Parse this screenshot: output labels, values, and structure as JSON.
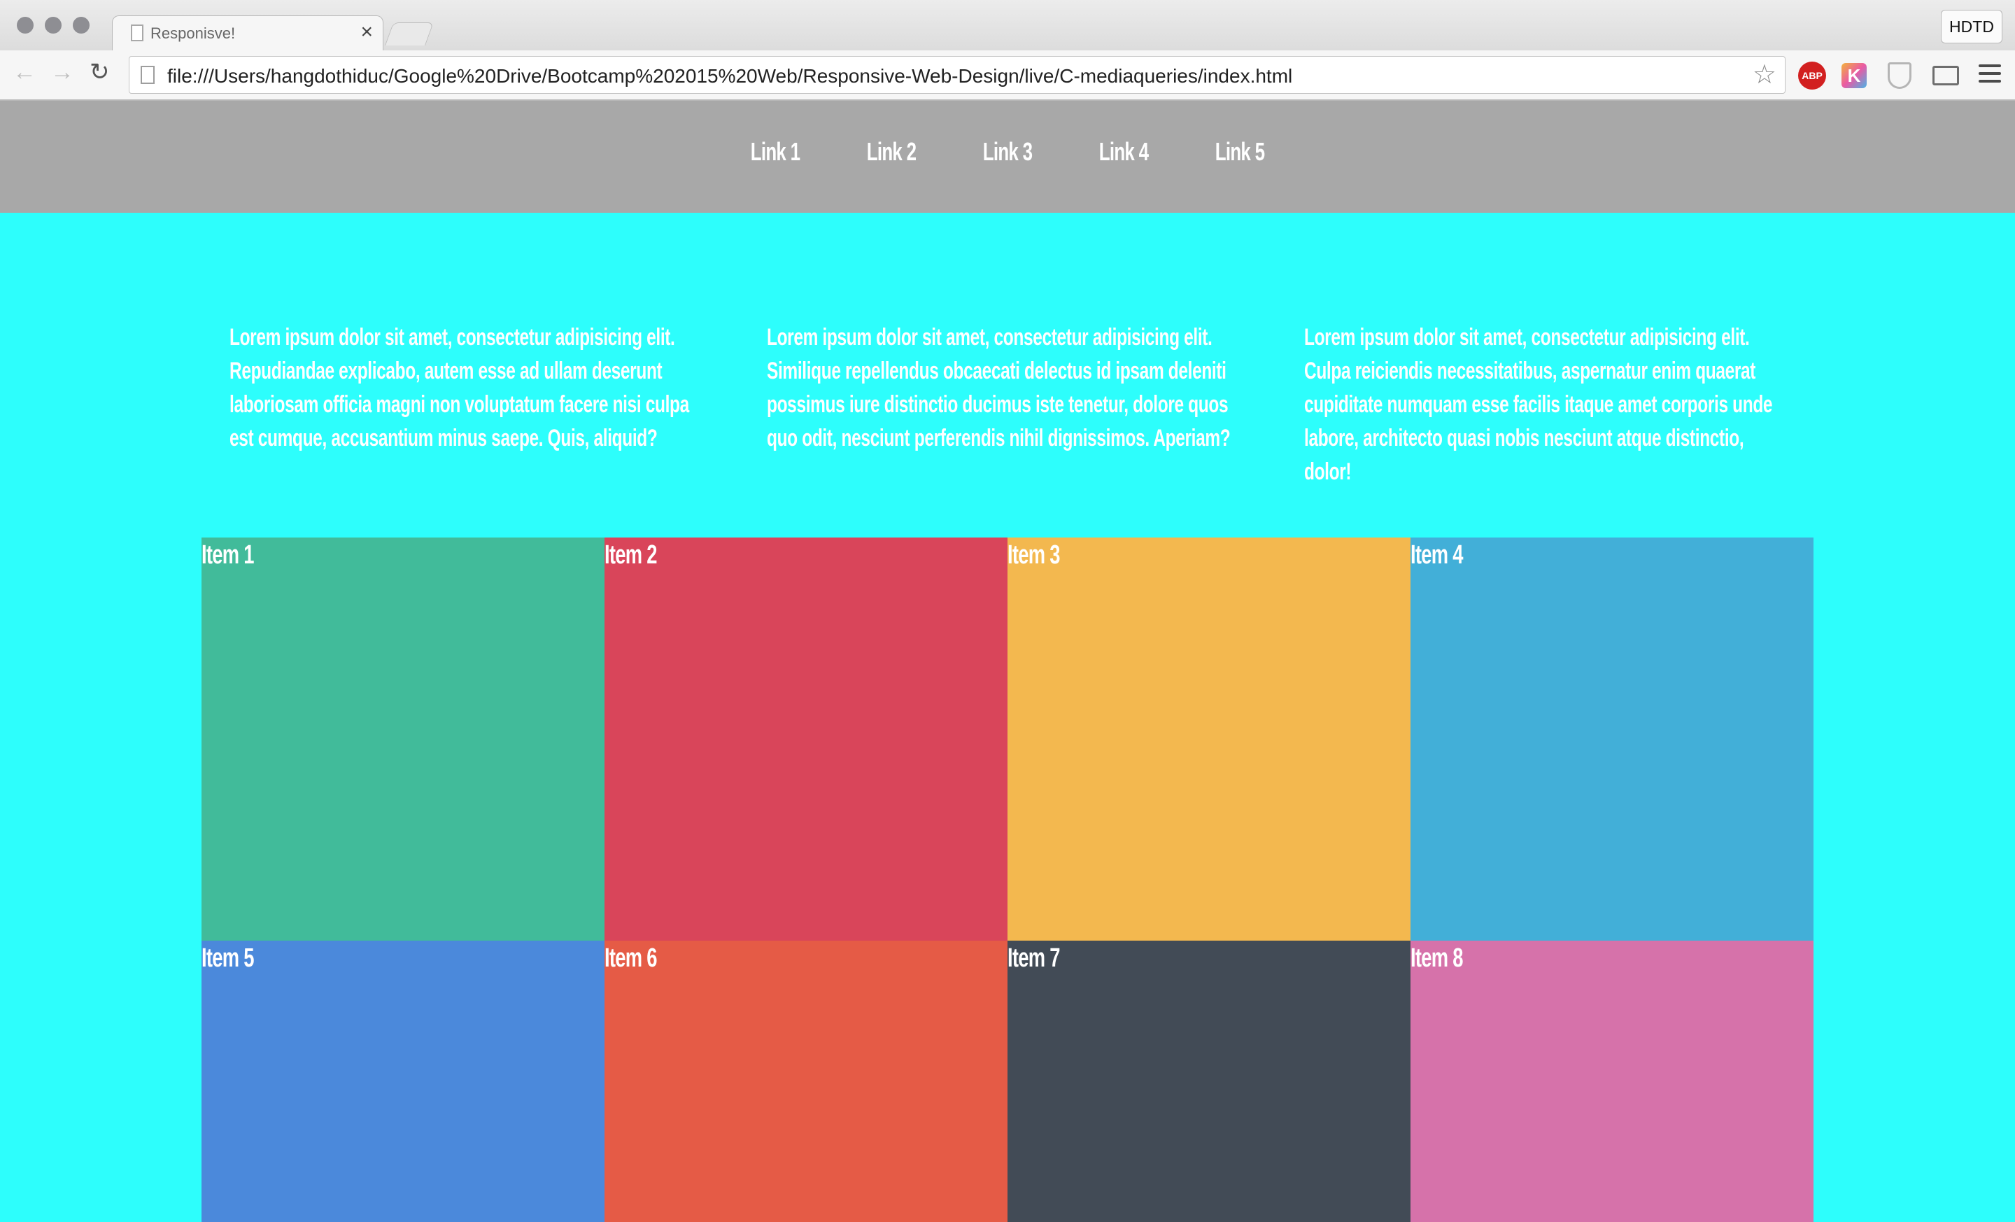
{
  "browser": {
    "tab_title": "Responisve!",
    "tab_close": "×",
    "profile_label": "HDTD",
    "url": "file:///Users/hangdothiduc/Google%20Drive/Bootcamp%202015%20Web/Responsive-Web-Design/live/C-mediaqueries/index.html",
    "back_icon": "←",
    "forward_icon": "→",
    "reload_icon": "↻",
    "star_icon": "☆",
    "abp_label": "ABP",
    "k_label": "K"
  },
  "nav": {
    "links": [
      "Link 1",
      "Link 2",
      "Link 3",
      "Link 4",
      "Link 5"
    ]
  },
  "intro": {
    "columns": [
      "Lorem ipsum dolor sit amet, consectetur adipisicing elit. Repudiandae explicabo, autem esse ad ullam deserunt laboriosam officia magni non voluptatum facere nisi culpa est cumque, accusantium minus saepe. Quis, aliquid?",
      "Lorem ipsum dolor sit amet, consectetur adipisicing elit. Similique repellendus obcaecati delectus id ipsam deleniti possimus iure distinctio ducimus iste tenetur, dolore quos quo odit, nesciunt perferendis nihil dignissimos. Aperiam?",
      "Lorem ipsum dolor sit amet, consectetur adipisicing elit. Culpa reiciendis necessitatibus, aspernatur enim quaerat cupiditate numquam esse facilis itaque amet corporis unde labore, architecto quasi nobis nesciunt atque distinctio, dolor!"
    ]
  },
  "grid": {
    "items": [
      {
        "label": "Item 1",
        "color": "#41bb9a"
      },
      {
        "label": "Item 2",
        "color": "#d9455a"
      },
      {
        "label": "Item 3",
        "color": "#f3b84f"
      },
      {
        "label": "Item 4",
        "color": "#42afd8"
      },
      {
        "label": "Item 5",
        "color": "#4b89db"
      },
      {
        "label": "Item 6",
        "color": "#e55b46"
      },
      {
        "label": "Item 7",
        "color": "#424b56"
      },
      {
        "label": "Item 8",
        "color": "#d672aa"
      }
    ]
  },
  "colors": {
    "page_background": "#2dfefc",
    "nav_background": "#a8a8a8",
    "text": "#ffffff"
  }
}
